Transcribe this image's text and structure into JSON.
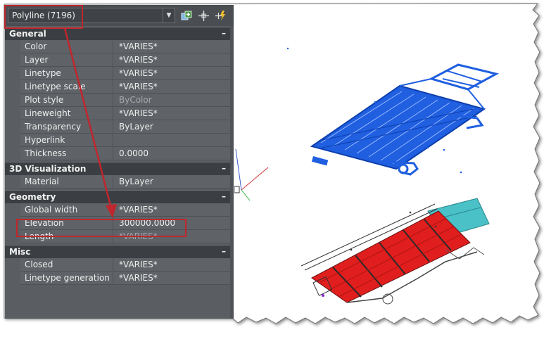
{
  "properties_panel": {
    "selection": "Polyline (7196)",
    "sections": [
      {
        "title": "General",
        "toggle": "–",
        "rows": [
          {
            "name": "Color",
            "value": "*VARIES*"
          },
          {
            "name": "Layer",
            "value": "*VARIES*"
          },
          {
            "name": "Linetype",
            "value": "*VARIES*"
          },
          {
            "name": "Linetype scale",
            "value": "*VARIES*"
          },
          {
            "name": "Plot style",
            "value": "ByColor"
          },
          {
            "name": "Lineweight",
            "value": "*VARIES*"
          },
          {
            "name": "Transparency",
            "value": "ByLayer"
          },
          {
            "name": "Hyperlink",
            "value": ""
          },
          {
            "name": "Thickness",
            "value": "0.0000"
          }
        ]
      },
      {
        "title": "3D Visualization",
        "toggle": "–",
        "rows": [
          {
            "name": "Material",
            "value": "ByLayer"
          }
        ]
      },
      {
        "title": "Geometry",
        "toggle": "–",
        "rows": [
          {
            "name": "Global width",
            "value": "*VARIES*"
          },
          {
            "name": "Elevation",
            "value": "300000.0000"
          },
          {
            "name": "Length",
            "value": "*VARIES*"
          }
        ]
      },
      {
        "title": "Misc",
        "toggle": "–",
        "rows": [
          {
            "name": "Closed",
            "value": "*VARIES*"
          },
          {
            "name": "Linetype generation",
            "value": "*VARIES*"
          }
        ]
      }
    ]
  },
  "colors": {
    "panel_bg": "#5a5d61",
    "highlight": "#c0262d",
    "selected_objects": "#1f5fe0",
    "hatch_red": "#e01e1e",
    "hatch_cyan": "#49c1c7"
  }
}
